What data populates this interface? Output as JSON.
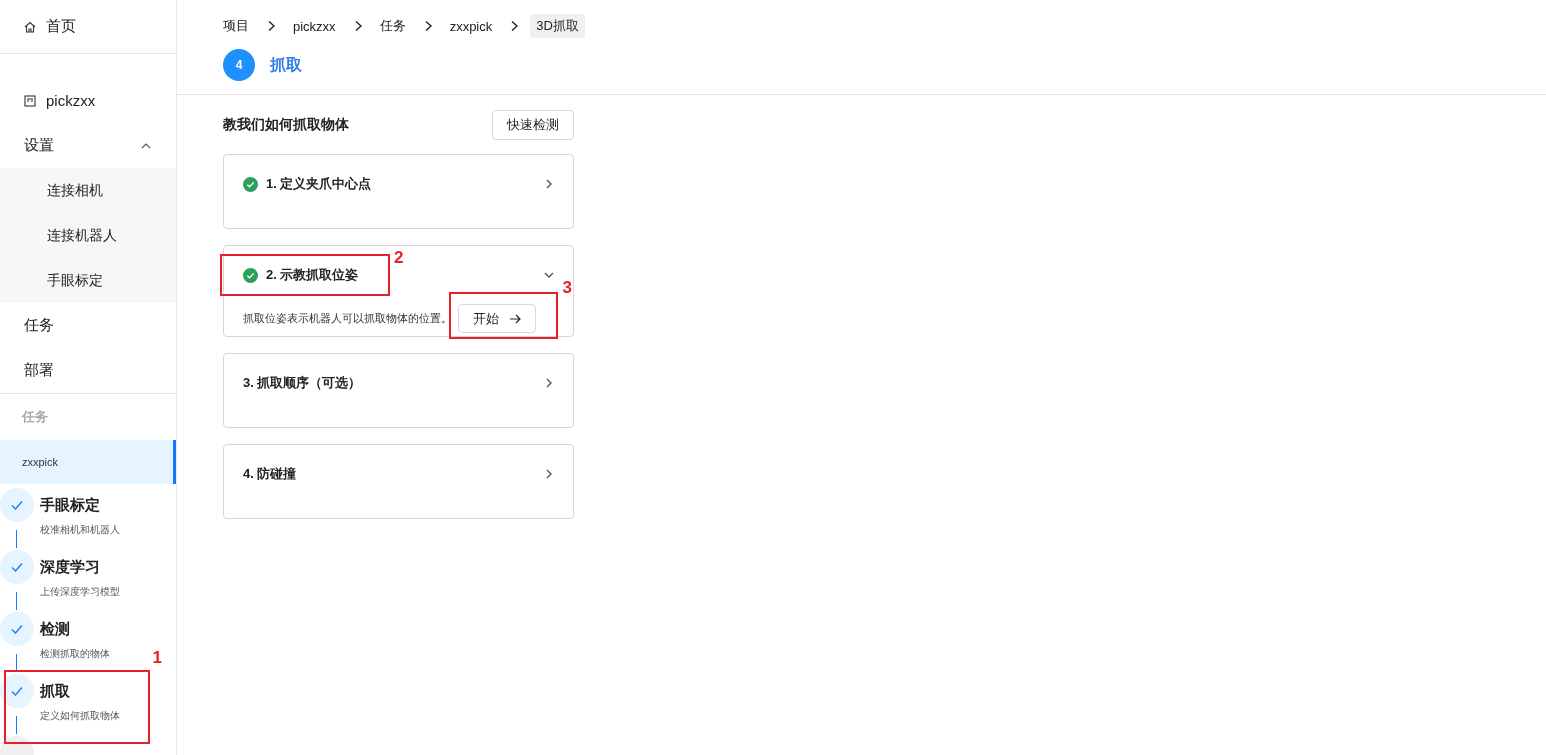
{
  "sidebar": {
    "items": [
      {
        "kind": "home",
        "label": "首页"
      },
      {
        "kind": "project",
        "label": "pickzxx"
      },
      {
        "kind": "group",
        "label": "设置",
        "expanded": true,
        "children": [
          {
            "label": "连接相机"
          },
          {
            "label": "连接机器人"
          },
          {
            "label": "手眼标定"
          }
        ]
      },
      {
        "kind": "item",
        "label": "任务"
      },
      {
        "kind": "item",
        "label": "部署"
      }
    ],
    "section_label": "任务",
    "task": {
      "label": "zxxpick",
      "selected": true
    },
    "steps": [
      {
        "title": "手眼标定",
        "description": "校准相机和机器人",
        "done": true
      },
      {
        "title": "深度学习",
        "description": "上传深度学习模型",
        "done": true
      },
      {
        "title": "检测",
        "description": "检测抓取的物体",
        "done": true
      },
      {
        "title": "抓取",
        "description": "定义如何抓取物体",
        "done": true,
        "callout": "1"
      }
    ]
  },
  "breadcrumb": [
    {
      "label": "项目"
    },
    {
      "label": "pickzxx"
    },
    {
      "label": "任务"
    },
    {
      "label": "zxxpick"
    },
    {
      "label": "3D抓取",
      "current": true
    }
  ],
  "header": {
    "step_number": "4",
    "title": "抓取"
  },
  "section": {
    "title": "教我们如何抓取物体",
    "button": "快速检测"
  },
  "cards": [
    {
      "title": "1. 定义夹爪中心点",
      "done": true,
      "expanded": false
    },
    {
      "title": "2. 示教抓取位姿",
      "done": true,
      "expanded": true,
      "callout": "2",
      "description": "抓取位姿表示机器人可以抓取物体的位置。",
      "button": {
        "label": "开始",
        "callout": "3"
      }
    },
    {
      "title": "3. 抓取顺序（可选）",
      "done": false,
      "expanded": false
    },
    {
      "title": "4. 防碰撞",
      "done": false,
      "expanded": false
    }
  ]
}
